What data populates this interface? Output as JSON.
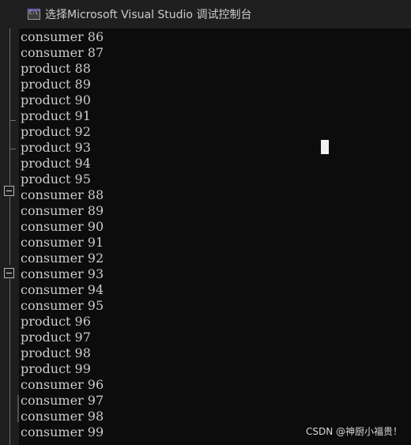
{
  "window": {
    "title": "选择Microsoft Visual Studio 调试控制台",
    "icon": "console-app-icon"
  },
  "console": {
    "lines": [
      "consumer 86",
      "consumer 87",
      "product 88",
      "product 89",
      "product 90",
      "product 91",
      "product 92",
      "product 93",
      "product 94",
      "product 95",
      "consumer 88",
      "consumer 89",
      "consumer 90",
      "consumer 91",
      "consumer 92",
      "consumer 93",
      "consumer 94",
      "consumer 95",
      "product 96",
      "product 97",
      "product 98",
      "product 99",
      "consumer 96",
      "consumer 97",
      "consumer 98",
      "consumer 99"
    ]
  },
  "watermark": "CSDN @神厨小福贵！",
  "colors": {
    "background": "#0c0c0c",
    "text": "#cccccc",
    "titlebar": "#1f1f1f",
    "gutter": "#1e1e1e"
  }
}
